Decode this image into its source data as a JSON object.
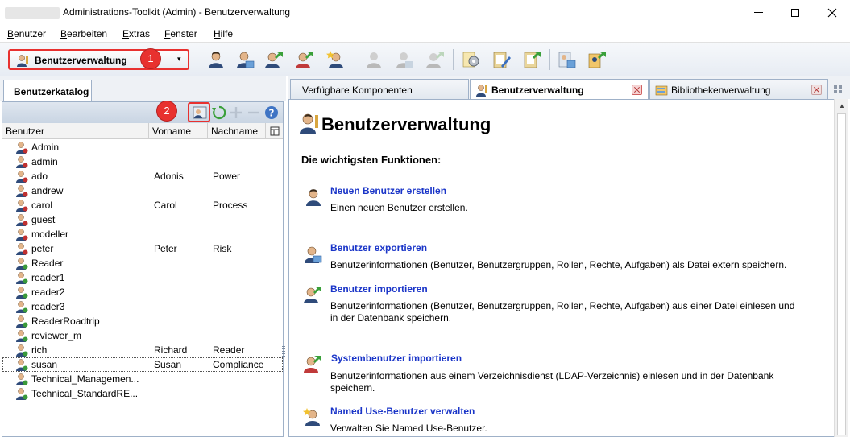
{
  "window": {
    "title": "Administrations-Toolkit (Admin) - Benutzerverwaltung",
    "minimize_icon": "minimize-icon",
    "maximize_icon": "maximize-icon",
    "close_icon": "close-icon"
  },
  "menu": {
    "items": [
      {
        "label": "Benutzer",
        "accel": "B"
      },
      {
        "label": "Bearbeiten",
        "accel": "B"
      },
      {
        "label": "Extras",
        "accel": "E"
      },
      {
        "label": "Fenster",
        "accel": "F"
      },
      {
        "label": "Hilfe",
        "accel": "H"
      }
    ]
  },
  "toolbar": {
    "module_select": {
      "value": "Benutzerverwaltung",
      "icon": "user-admin-icon"
    },
    "badge1": "1",
    "badge2": "2"
  },
  "left_panel": {
    "tab_label": "Benutzerkatalog",
    "columns": [
      "Benutzer",
      "Vorname",
      "Nachname"
    ],
    "rows": [
      {
        "user": "Admin",
        "first": "",
        "last": "",
        "color": "#c03030"
      },
      {
        "user": "admin",
        "first": "",
        "last": "",
        "color": "#c03030"
      },
      {
        "user": "ado",
        "first": "Adonis",
        "last": "Power",
        "color": "#c03030"
      },
      {
        "user": "andrew",
        "first": "",
        "last": "",
        "color": "#c03030"
      },
      {
        "user": "carol",
        "first": "Carol",
        "last": "Process",
        "color": "#c03030"
      },
      {
        "user": "guest",
        "first": "",
        "last": "",
        "color": "#c03030"
      },
      {
        "user": "modeller",
        "first": "",
        "last": "",
        "color": "#c03030"
      },
      {
        "user": "peter",
        "first": "Peter",
        "last": "Risk",
        "color": "#c03030"
      },
      {
        "user": "Reader",
        "first": "",
        "last": "",
        "color": "#3a9a3a"
      },
      {
        "user": "reader1",
        "first": "",
        "last": "",
        "color": "#3a9a3a"
      },
      {
        "user": "reader2",
        "first": "",
        "last": "",
        "color": "#3a9a3a"
      },
      {
        "user": "reader3",
        "first": "",
        "last": "",
        "color": "#3a9a3a"
      },
      {
        "user": "ReaderRoadtrip",
        "first": "",
        "last": "",
        "color": "#3a9a3a"
      },
      {
        "user": "reviewer_m",
        "first": "",
        "last": "",
        "color": "#3a9a3a"
      },
      {
        "user": "rich",
        "first": "Richard",
        "last": "Reader",
        "color": "#3a9a3a"
      },
      {
        "user": "susan",
        "first": "Susan",
        "last": "Compliance",
        "color": "#3a9a3a"
      },
      {
        "user": "Technical_Managemen...",
        "first": "",
        "last": "",
        "color": "#3a9a3a"
      },
      {
        "user": "Technical_StandardRE...",
        "first": "",
        "last": "",
        "color": "#3a9a3a"
      }
    ],
    "selected_index": 15
  },
  "tabs": [
    {
      "label": "Verfügbare Komponenten",
      "active": false
    },
    {
      "label": "Benutzerverwaltung",
      "active": true
    },
    {
      "label": "Bibliothekenverwaltung",
      "active": false
    }
  ],
  "content": {
    "title": "Benutzerverwaltung",
    "section_title": "Die wichtigsten Funktionen:",
    "functions": [
      {
        "link": "Neuen Benutzer erstellen",
        "desc": "Einen neuen Benutzer erstellen.",
        "icon": "new-user-icon"
      },
      {
        "link": "Benutzer exportieren",
        "desc": "Benutzerinformationen (Benutzer, Benutzergruppen, Rollen, Rechte, Aufgaben) als Datei extern speichern.",
        "icon": "export-user-icon"
      },
      {
        "link": "Benutzer importieren",
        "desc": "Benutzerinformationen (Benutzer, Benutzergruppen, Rollen, Rechte, Aufgaben) aus einer Datei einlesen und in der Datenbank speichern.",
        "icon": "import-user-icon"
      },
      {
        "link": "Systembenutzer importieren",
        "desc": "Benutzerinformationen aus einem Verzeichnisdienst (LDAP-Verzeichnis) einlesen und in der Datenbank speichern.",
        "icon": "system-user-import-icon"
      },
      {
        "link": "Named Use-Benutzer verwalten",
        "desc": "Verwalten Sie Named Use-Benutzer.",
        "icon": "named-user-icon"
      }
    ]
  }
}
